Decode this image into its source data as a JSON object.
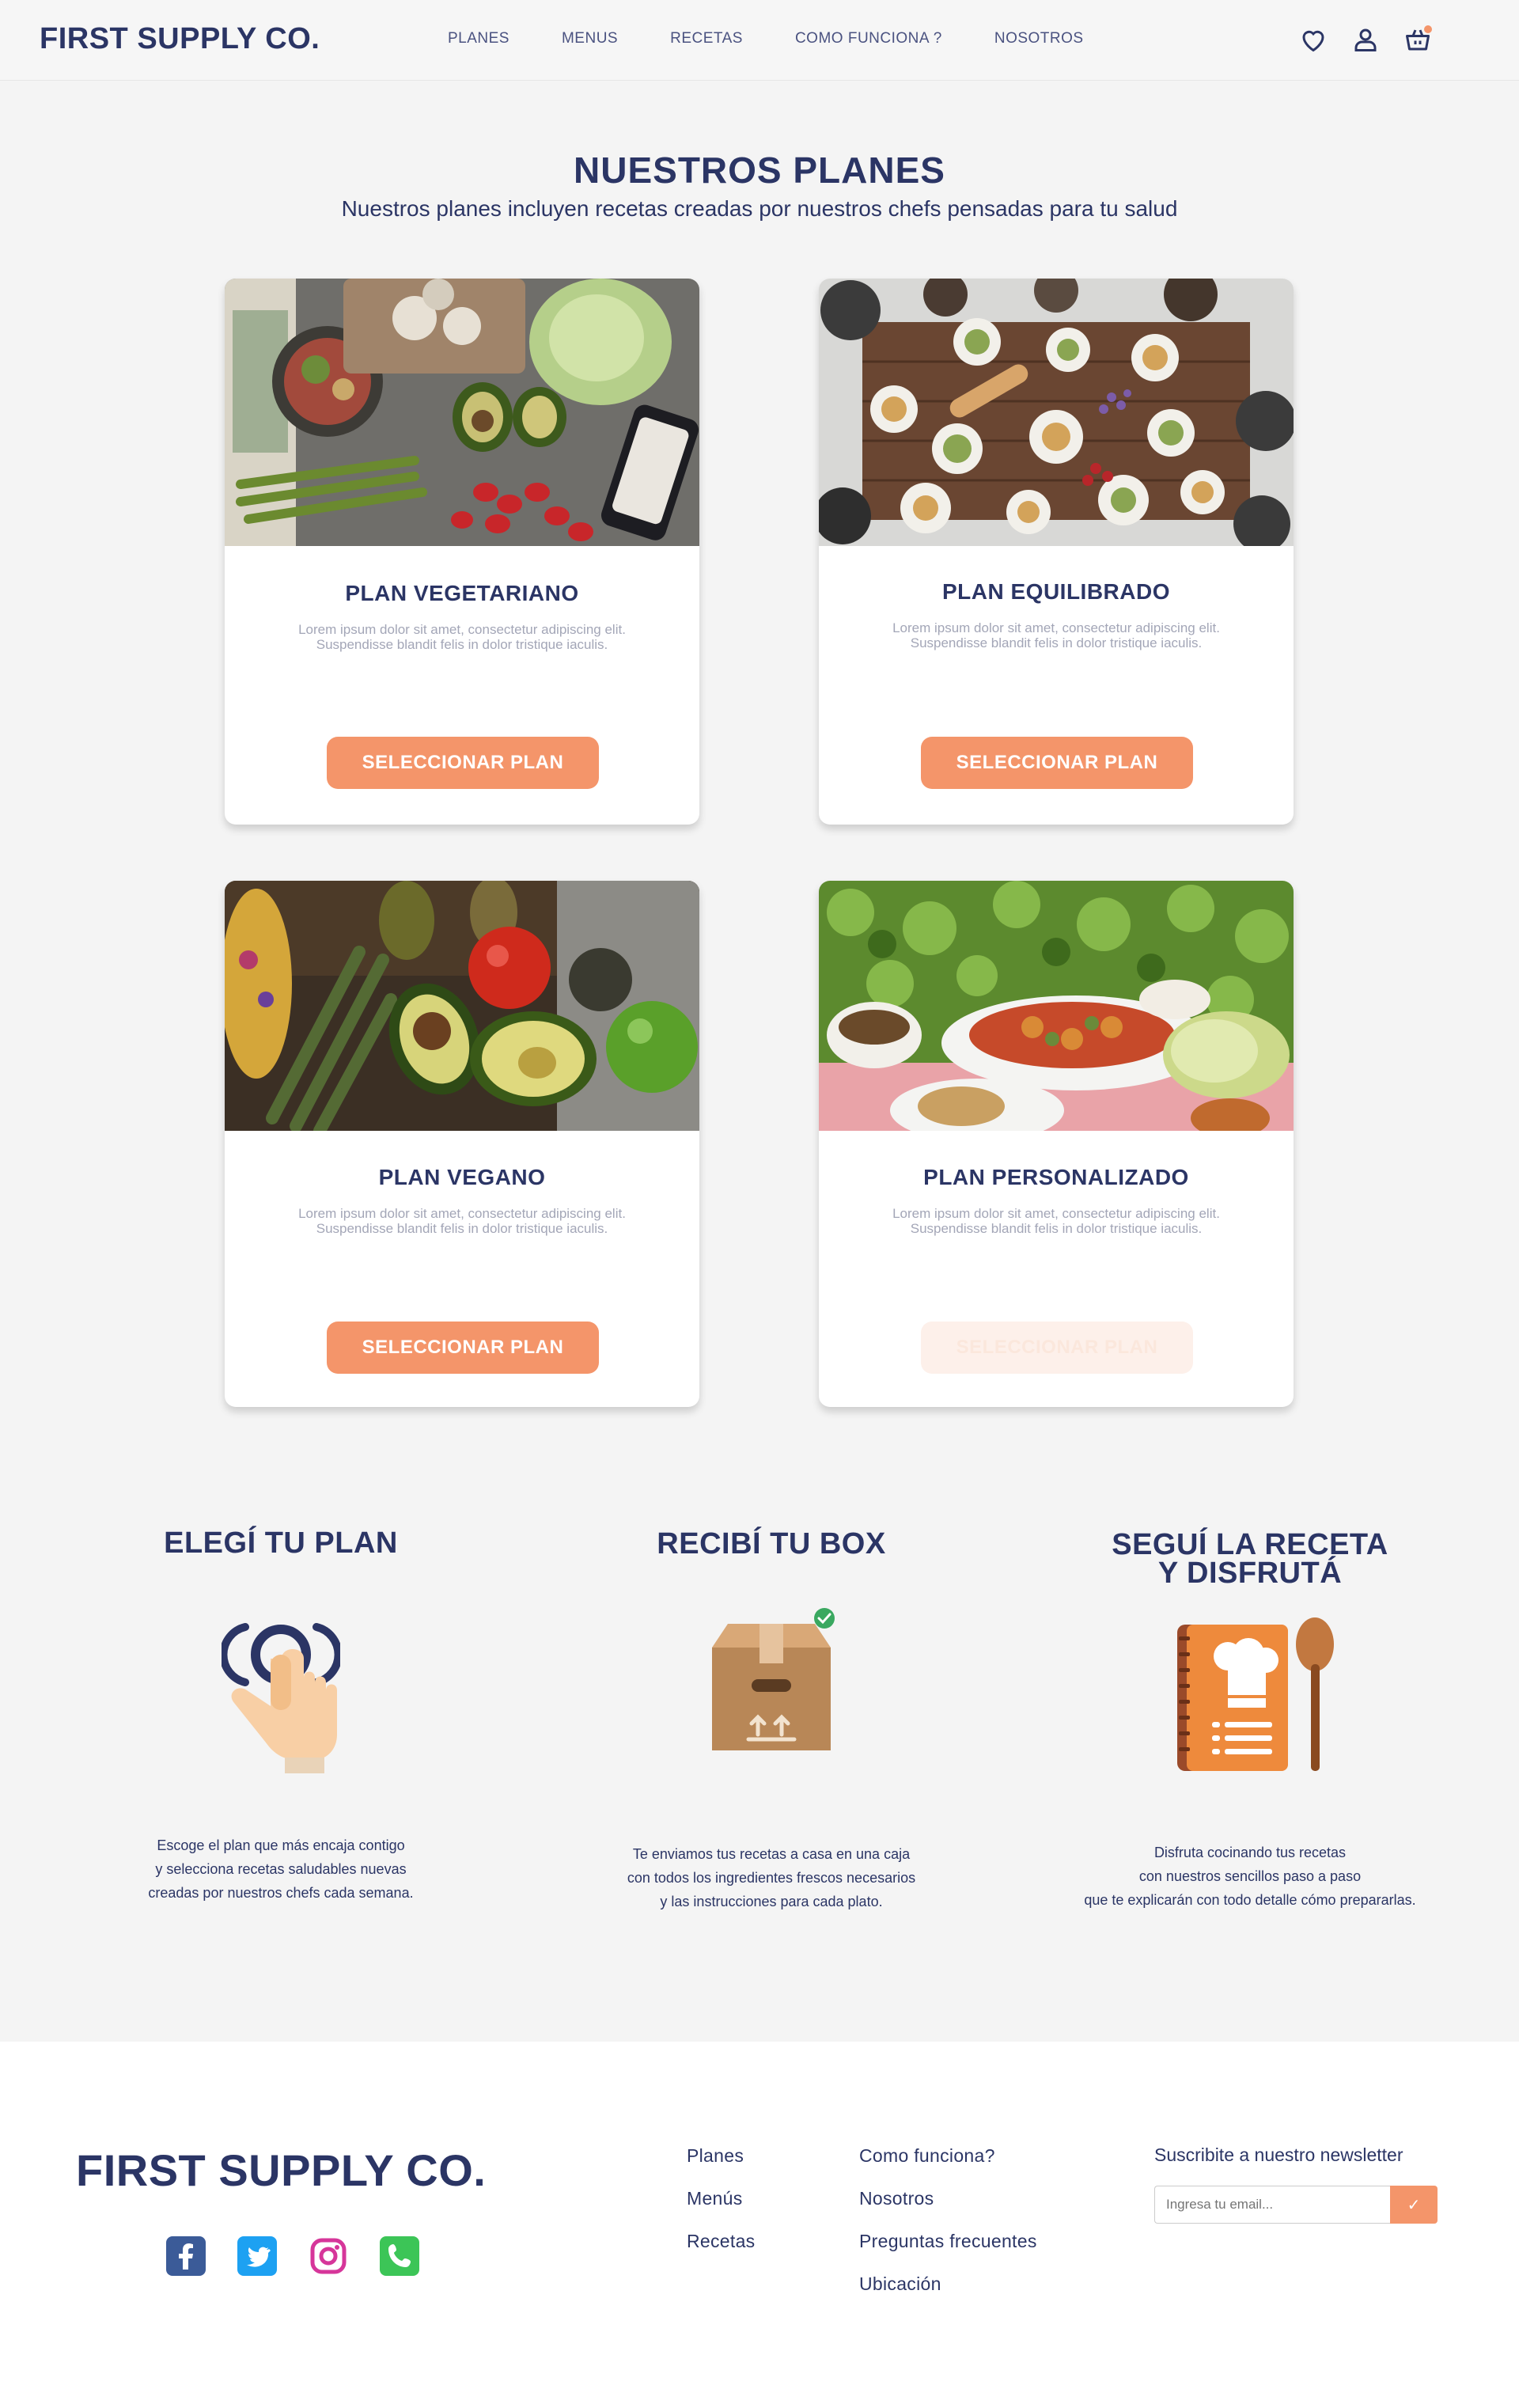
{
  "header": {
    "logo": "FIRST SUPPLY CO.",
    "nav": [
      "PLANES",
      "MENUS",
      "RECETAS",
      "COMO FUNCIONA ?",
      "NOSOTROS"
    ],
    "icons": [
      "heart-icon",
      "user-icon",
      "basket-icon"
    ]
  },
  "plans_section": {
    "title": "NUESTROS  PLANES",
    "subtitle": "Nuestros planes incluyen recetas creadas por nuestros chefs pensadas para tu salud"
  },
  "plans": [
    {
      "title": "PLAN VEGETARIANO",
      "desc_line1": "Lorem ipsum dolor sit amet, consectetur adipiscing elit.",
      "desc_line2": "Suspendisse blandit felis in dolor tristique iaculis.",
      "button": "SELECCIONAR PLAN",
      "button_state": "enabled"
    },
    {
      "title": "PLAN EQUILIBRADO",
      "desc_line1": "Lorem ipsum dolor sit amet, consectetur adipiscing elit.",
      "desc_line2": "Suspendisse blandit felis in dolor tristique iaculis.",
      "button": "SELECCIONAR PLAN",
      "button_state": "enabled"
    },
    {
      "title": "PLAN VEGANO",
      "desc_line1": "Lorem ipsum dolor sit amet, consectetur adipiscing elit.",
      "desc_line2": "Suspendisse blandit felis in dolor tristique iaculis.",
      "button": "SELECCIONAR PLAN",
      "button_state": "enabled"
    },
    {
      "title": "PLAN PERSONALIZADO",
      "desc_line1": "Lorem ipsum dolor sit amet, consectetur adipiscing elit.",
      "desc_line2": "Suspendisse blandit felis in dolor tristique iaculis.",
      "button": "SELECCIONAR PLAN",
      "button_state": "disabled"
    }
  ],
  "steps": [
    {
      "title_line1": "ELEGÍ TU PLAN",
      "title_line2": "",
      "icon": "hand-tap-icon",
      "text_line1": "Escoge el plan que más encaja contigo",
      "text_line2": "y selecciona recetas saludables nuevas",
      "text_line3": "creadas por nuestros chefs cada semana."
    },
    {
      "title_line1": "RECIBÍ TU BOX",
      "title_line2": "",
      "icon": "delivery-box-icon",
      "text_line1": "Te enviamos tus recetas a casa en una caja",
      "text_line2": "con todos los ingredientes frescos necesarios",
      "text_line3": "y las instrucciones para cada plato."
    },
    {
      "title_line1": "SEGUÍ LA RECETA",
      "title_line2": "Y DISFRUTÁ",
      "icon": "recipe-book-spoon-icon",
      "text_line1": "Disfruta cocinando tus recetas",
      "text_line2": "con nuestros sencillos paso a paso",
      "text_line3": "que te explicarán con todo detalle cómo prepararlas."
    }
  ],
  "footer": {
    "logo": "FIRST SUPPLY CO.",
    "social": [
      "facebook-icon",
      "twitter-icon",
      "instagram-icon",
      "phone-icon"
    ],
    "links_col1": [
      "Planes",
      "Menús",
      "Recetas"
    ],
    "links_col2": [
      "Como funciona?",
      "Nosotros",
      "Preguntas frecuentes",
      "Ubicación"
    ],
    "newsletter_title": "Suscribite a nuestro newsletter",
    "newsletter_placeholder": "Ingresa tu email..."
  },
  "colors": {
    "navy": "#2b3565",
    "accent": "#f4956a",
    "background": "#f4f4f4"
  }
}
